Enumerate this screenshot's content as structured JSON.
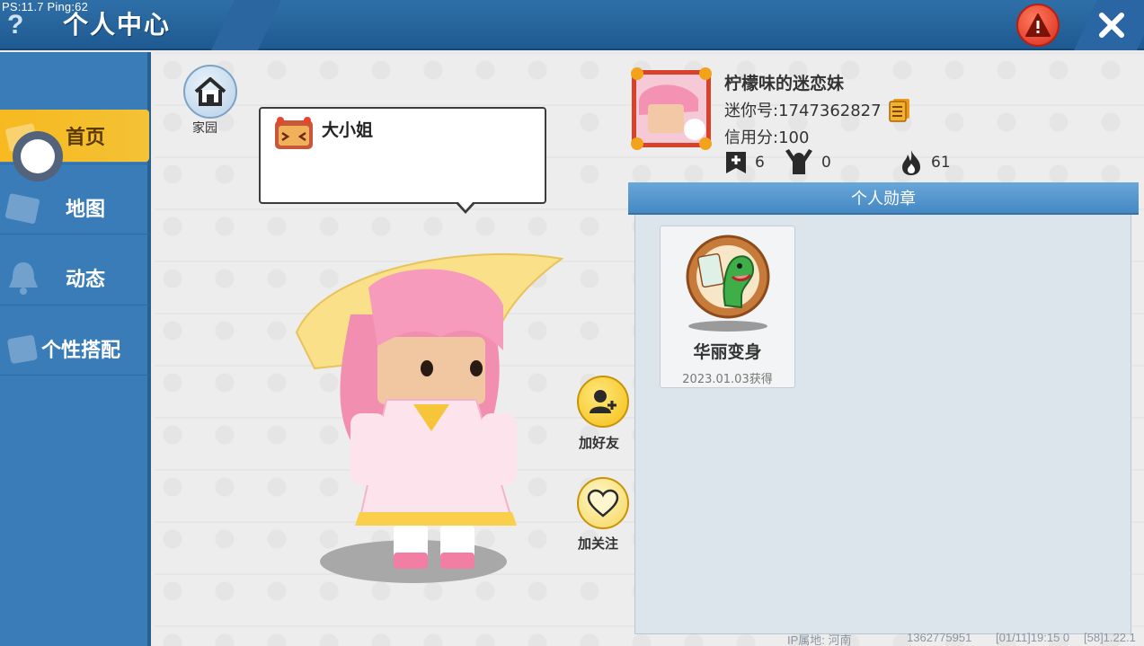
{
  "debug": {
    "fps_ping": "PS:11.7  Ping:62"
  },
  "header": {
    "help_icon": "question-icon",
    "title": "个人中心",
    "warning_icon": "warning-icon",
    "close_icon": "close-icon"
  },
  "sidebar": {
    "items": [
      {
        "label": "首页",
        "icon": "home-card-icon",
        "active": true
      },
      {
        "label": "地图",
        "icon": "map-icon",
        "active": false
      },
      {
        "label": "动态",
        "icon": "bell-icon",
        "active": false
      },
      {
        "label": "个性搭配",
        "icon": "outfit-icon",
        "active": false
      }
    ]
  },
  "home": {
    "label": "家园"
  },
  "speech": {
    "title": "大小姐"
  },
  "actions": {
    "add_friend": "加好友",
    "follow": "加关注"
  },
  "profile": {
    "nickname": "柠檬味的迷恋妹",
    "mini_id": "迷你号:1747362827",
    "credit": "信用分:100",
    "stats": [
      {
        "icon": "plus-flag-icon",
        "value": "6"
      },
      {
        "icon": "cheer-icon",
        "value": "0"
      },
      {
        "icon": "flame-icon",
        "value": "61"
      }
    ]
  },
  "medals": {
    "header": "个人勋章",
    "items": [
      {
        "name": "华丽变身",
        "date": "2023.01.03获得"
      }
    ]
  },
  "footer": {
    "ip": "IP属地: 河南",
    "uid": "1362775951",
    "time": "[01/11]19:15 0",
    "version": "[58]1.22.1"
  },
  "colors": {
    "topbar": "#2a67a2",
    "sidebar": "#3a7cb8",
    "sidebar_active": "#f5bd25",
    "medal_header": "#4e8fc9",
    "action_yellow": "#f4c01c"
  }
}
